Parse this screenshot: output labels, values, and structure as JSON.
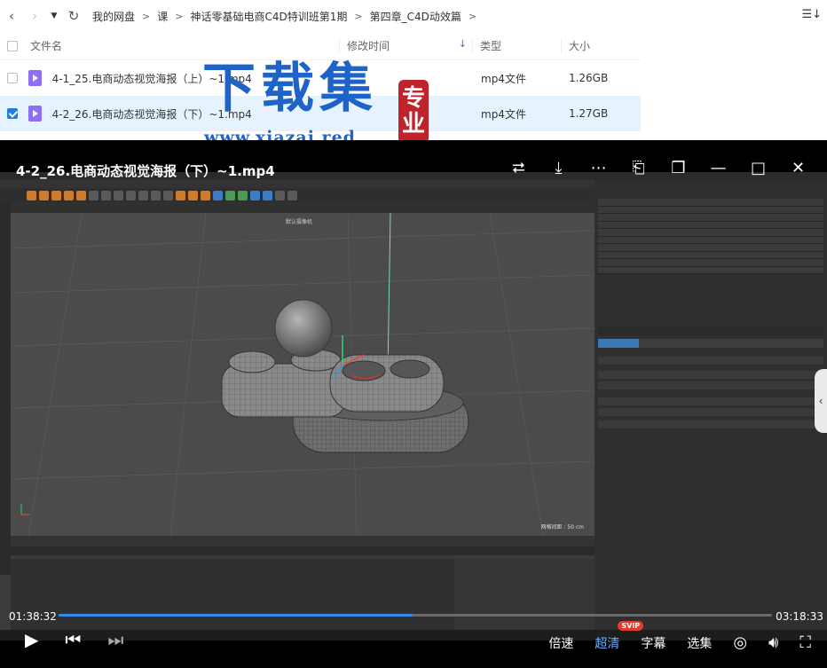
{
  "breadcrumb": [
    "我的网盘",
    "课",
    "神话零基础电商C4D特训班第1期",
    "第四章_C4D动效篇"
  ],
  "list_header": {
    "name": "文件名",
    "modified": "修改时间",
    "type": "类型",
    "size": "大小"
  },
  "files": [
    {
      "name": "4-1_25.电商动态视觉海报（上）~1.mp4",
      "type": "mp4文件",
      "size": "1.26GB",
      "checked": false
    },
    {
      "name": "4-2_26.电商动态视觉海报（下）~1.mp4",
      "type": "mp4文件",
      "size": "1.27GB",
      "checked": true
    }
  ],
  "watermark": {
    "main": "下载集",
    "url": "www.xiazai.red",
    "seal": [
      "专",
      "业"
    ]
  },
  "player": {
    "title": "4-2_26.电商动态视觉海报（下）~1.mp4",
    "current_time": "01:38:32",
    "duration": "03:18:33",
    "progress_fraction": 0.496,
    "viewport_label": "默认摄像机",
    "grid_label": "网格间距 : 50 cm",
    "controls": {
      "speed": "倍速",
      "quality": "超清",
      "quality_badge": "SVIP",
      "subtitle": "字幕",
      "episodes": "选集"
    }
  },
  "colors": {
    "accent": "#1e7de0",
    "selected_row": "#e6f2fe",
    "progress": "#2e8cf0",
    "watermark": "#1e63c8",
    "seal": "#c0232b"
  }
}
